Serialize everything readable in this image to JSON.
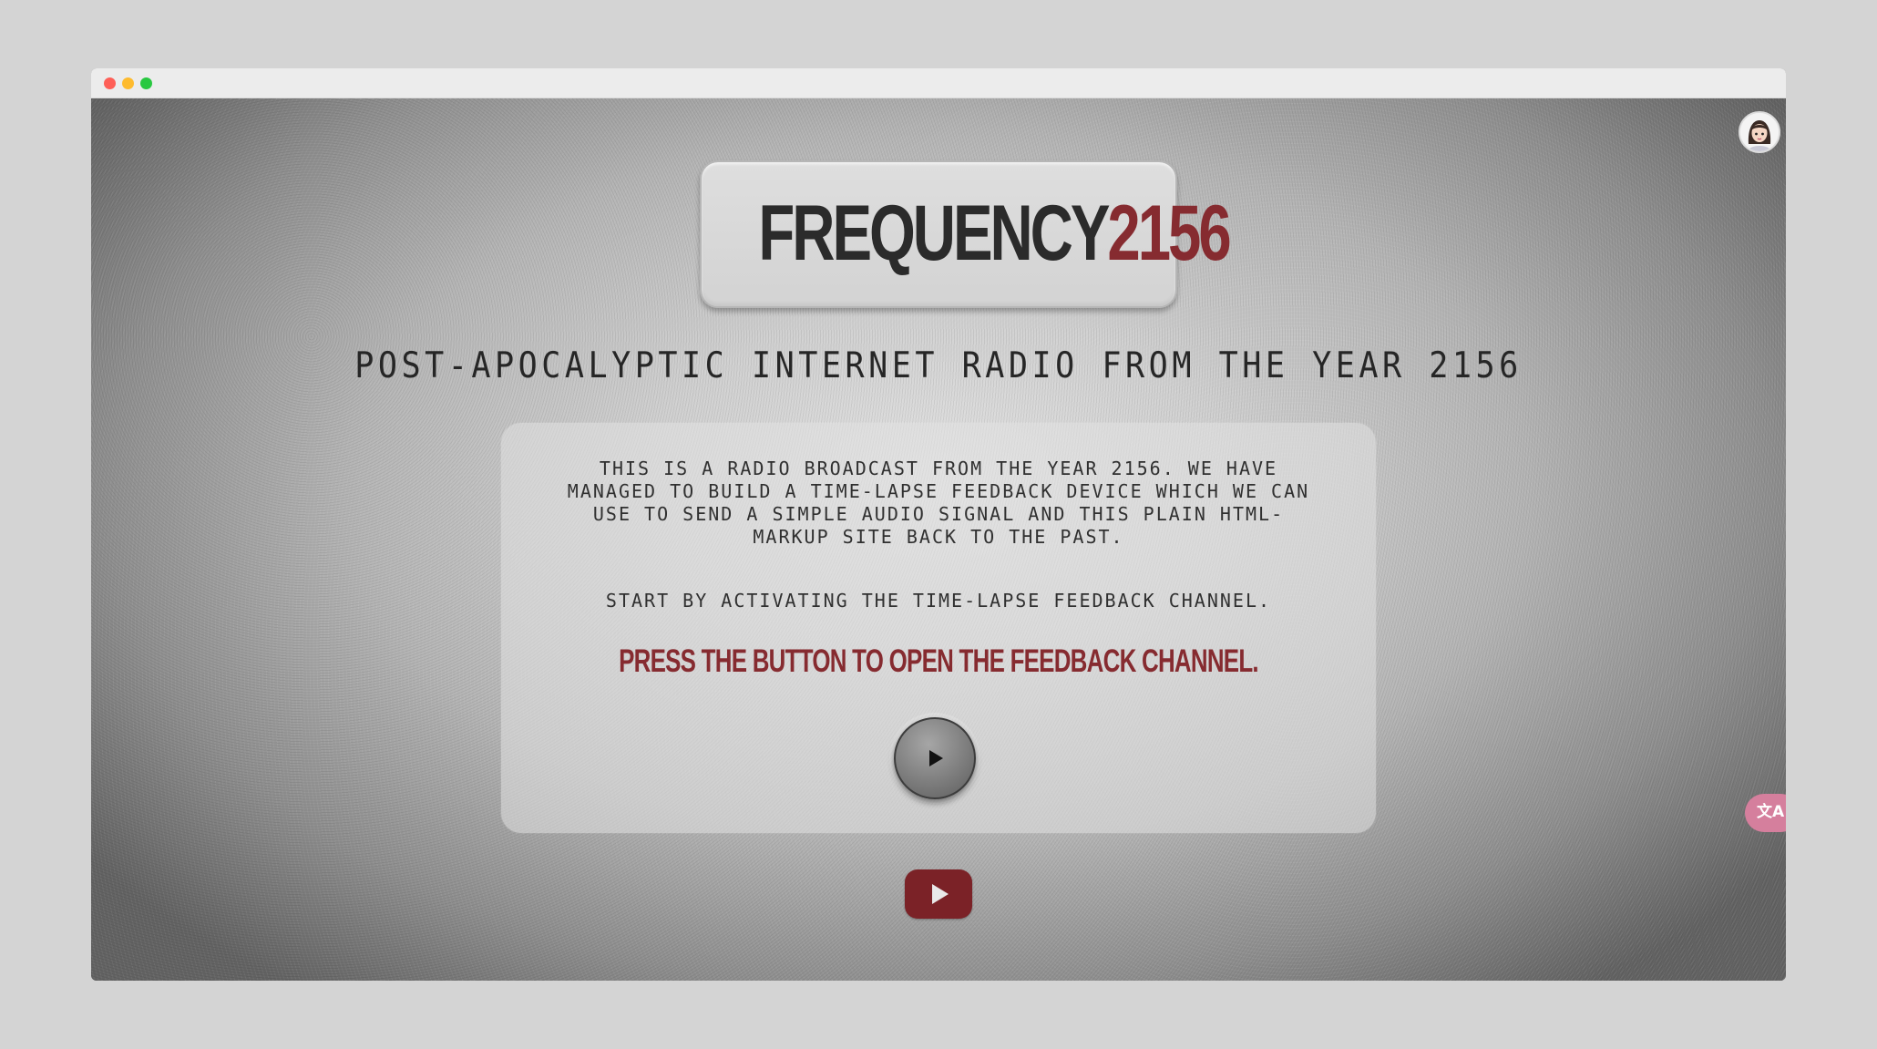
{
  "window": {
    "controls": [
      "close",
      "minimize",
      "maximize"
    ]
  },
  "logo": {
    "word": "FREQUENCY",
    "number": "2156"
  },
  "subtitle": "POST-APOCALYPTIC INTERNET RADIO FROM THE YEAR 2156",
  "panel": {
    "intro": "THIS IS A RADIO BROADCAST FROM THE YEAR 2156. WE HAVE MANAGED TO BUILD A TIME-LAPSE FEEDBACK DEVICE WHICH WE CAN USE TO SEND A SIMPLE AUDIO SIGNAL AND THIS PLAIN HTML-MARKUP SITE BACK TO THE PAST.",
    "start": "START BY ACTIVATING THE TIME-LAPSE FEEDBACK CHANNEL.",
    "call_to_action": "PRESS THE BUTTON TO OPEN THE FEEDBACK CHANNEL.",
    "play_icon": "play-icon"
  },
  "youtube": {
    "icon": "youtube-icon"
  },
  "extensions": {
    "avatar_icon": "avatar-icon",
    "translate_label": "文A"
  },
  "colors": {
    "accent_red": "#862b30",
    "logo_dark": "#2b2b2b",
    "youtube_red": "#7b2227",
    "translate_pink": "#d57f9d"
  }
}
